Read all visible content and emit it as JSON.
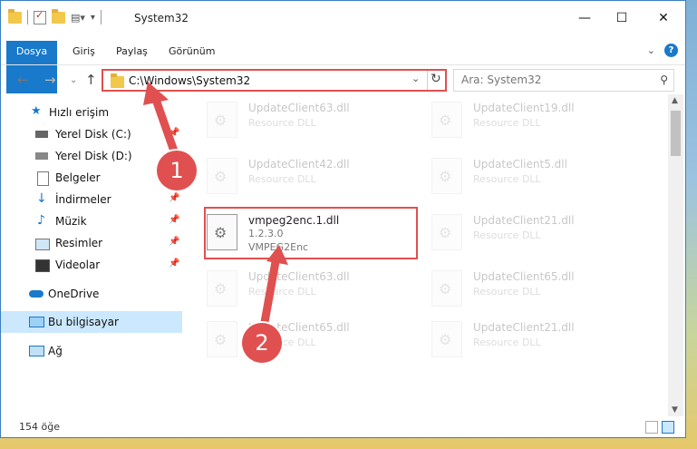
{
  "window": {
    "title": "System32",
    "controls": {
      "minimize": "—",
      "maximize": "☐",
      "close": "✕"
    }
  },
  "ribbon": {
    "tabs": [
      {
        "label": "Dosya"
      },
      {
        "label": "Giriş"
      },
      {
        "label": "Paylaş"
      },
      {
        "label": "Görünüm"
      }
    ]
  },
  "nav": {
    "address": "C:\\Windows\\System32",
    "search_placeholder": "Ara: System32"
  },
  "sidebar": {
    "items": [
      {
        "label": "Hızlı erişim",
        "icon": "star-icon",
        "pinned": false
      },
      {
        "label": "Yerel Disk (C:)",
        "icon": "drive-icon",
        "pinned": true
      },
      {
        "label": "Yerel Disk (D:)",
        "icon": "drive-icon",
        "pinned": true
      },
      {
        "label": "Belgeler",
        "icon": "document-icon",
        "pinned": true
      },
      {
        "label": "İndirmeler",
        "icon": "download-icon",
        "pinned": true
      },
      {
        "label": "Müzik",
        "icon": "music-icon",
        "pinned": true
      },
      {
        "label": "Resimler",
        "icon": "picture-icon",
        "pinned": true
      },
      {
        "label": "Videolar",
        "icon": "video-icon",
        "pinned": true
      },
      {
        "label": "OneDrive",
        "icon": "cloud-icon",
        "pinned": false
      },
      {
        "label": "Bu bilgisayar",
        "icon": "computer-icon",
        "pinned": false
      },
      {
        "label": "Ağ",
        "icon": "network-icon",
        "pinned": false
      }
    ]
  },
  "files": [
    {
      "name": "UpdateClient63.dll",
      "desc": "Resource DLL"
    },
    {
      "name": "UpdateClient19.dll",
      "desc": "Resource DLL"
    },
    {
      "name": "UpdateClient42.dll",
      "desc": "Resource DLL"
    },
    {
      "name": "UpdateClient5.dll",
      "desc": "Resource DLL"
    },
    {
      "name": "vmpeg2enc.1.dll",
      "version": "1.2.3.0",
      "desc": "VMPEG2Enc"
    },
    {
      "name": "UpdateClient21.dll",
      "desc": "Resource DLL"
    },
    {
      "name": "UpdateClient63.dll",
      "desc": "Resource DLL"
    },
    {
      "name": "UpdateClient65.dll",
      "desc": "Resource DLL"
    },
    {
      "name": "UpdateClient65.dll",
      "desc": "Resource DLL"
    },
    {
      "name": "UpdateClient21.dll",
      "desc": "Resource DLL"
    }
  ],
  "status": {
    "item_count": "154 öğe"
  },
  "annotations": {
    "badge1": "1",
    "badge2": "2",
    "color": "#e05050"
  }
}
